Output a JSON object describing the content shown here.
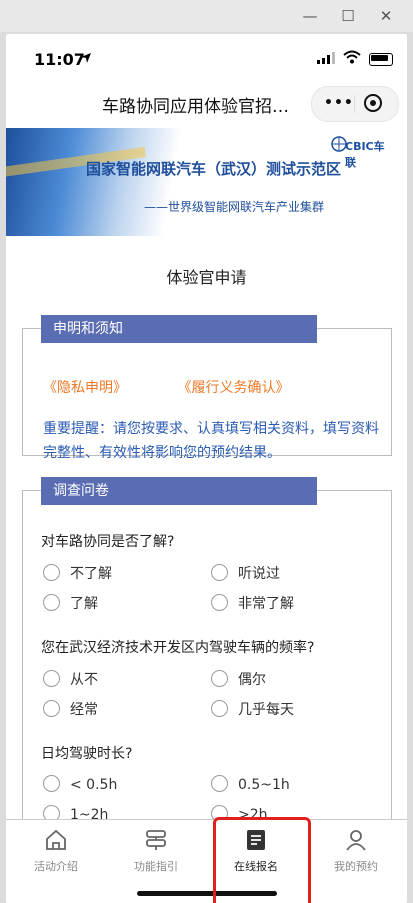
{
  "window": {
    "minimize": "—",
    "maximize": "☐",
    "close": "✕"
  },
  "status": {
    "time": "11:07",
    "location_icon": "location-arrow-icon"
  },
  "navbar": {
    "title": "车路协同应用体验官招…",
    "more": "•••"
  },
  "banner": {
    "logo": "CBIC车联",
    "title": "国家智能网联汽车（武汉）测试示范区",
    "subtitle": "——世界级智能网联汽车产业集群"
  },
  "page_title": "体验官申请",
  "declaration": {
    "header": "申明和须知",
    "privacy": "《隐私申明》",
    "obligation": "《履行义务确认》",
    "notice": "重要提醒：请您按要求、认真填写相关资料，填写资料完整性、有效性将影响您的预约结果。"
  },
  "survey": {
    "header": "调查问卷",
    "questions": [
      {
        "text": "对车路协同是否了解?",
        "options": [
          "不了解",
          "听说过",
          "了解",
          "非常了解"
        ]
      },
      {
        "text": "您在武汉经济技术开发区内驾驶车辆的频率?",
        "options": [
          "从不",
          "偶尔",
          "经常",
          "几乎每天"
        ]
      },
      {
        "text": "日均驾驶时长?",
        "options": [
          "< 0.5h",
          "0.5~1h",
          "1~2h",
          ">2h"
        ]
      }
    ]
  },
  "tabbar": {
    "tabs": [
      {
        "label": "活动介绍",
        "icon": "home-icon"
      },
      {
        "label": "功能指引",
        "icon": "signpost-icon"
      },
      {
        "label": "在线报名",
        "icon": "form-icon"
      },
      {
        "label": "我的预约",
        "icon": "user-icon"
      }
    ],
    "active": "在线报名"
  },
  "colors": {
    "accent": "#5b6db2",
    "link": "#ee7a27",
    "notice": "#2a5bb2",
    "highlight": "#e02020"
  }
}
